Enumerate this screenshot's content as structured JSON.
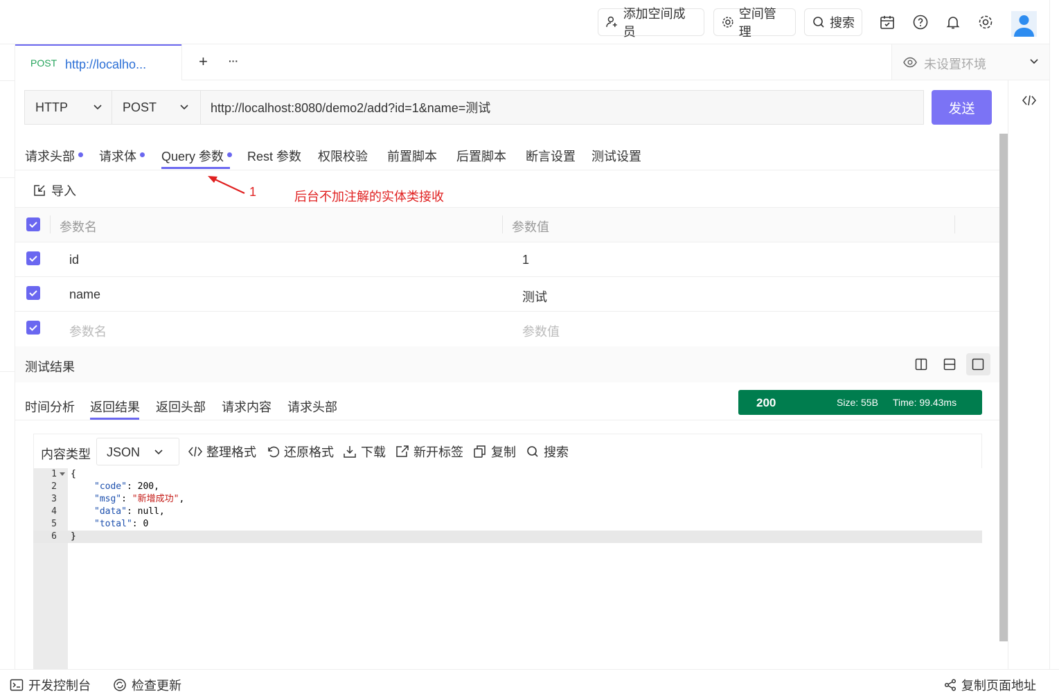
{
  "topbar": {
    "add_member": "添加空间成员",
    "space_manage": "空间管理",
    "search": "搜索"
  },
  "tabs": {
    "method": "POST",
    "title": "http://localho...",
    "add": "+",
    "more": "···"
  },
  "env": {
    "label": "未设置环境"
  },
  "request": {
    "protocol": "HTTP",
    "method": "POST",
    "url": "http://localhost:8080/demo2/add?id=1&name=测试",
    "send": "发送"
  },
  "req_tabs": [
    "请求头部",
    "请求体",
    "Query 参数",
    "Rest 参数",
    "权限校验",
    "前置脚本",
    "后置脚本",
    "断言设置",
    "测试设置"
  ],
  "import_label": "导入",
  "annotation": {
    "number": "1",
    "text": "后台不加注解的实体类接收"
  },
  "params": {
    "header_name": "参数名",
    "header_value": "参数值",
    "rows": [
      {
        "name": "id",
        "value": "1"
      },
      {
        "name": "name",
        "value": "测试"
      }
    ],
    "placeholder_name": "参数名",
    "placeholder_value": "参数值"
  },
  "result": {
    "title": "测试结果",
    "tabs": [
      "时间分析",
      "返回结果",
      "返回头部",
      "请求内容",
      "请求头部"
    ],
    "status": "200",
    "size": "Size: 55B",
    "time": "Time: 99.43ms"
  },
  "toolbar": {
    "content_type_label": "内容类型",
    "content_type": "JSON",
    "format": "整理格式",
    "restore": "还原格式",
    "download": "下载",
    "new_tab": "新开标签",
    "copy": "复制",
    "search": "搜索"
  },
  "code": {
    "lines": [
      {
        "n": "1",
        "t": "{"
      },
      {
        "n": "2",
        "k": "\"code\"",
        "v": ": 200,",
        "vs": ""
      },
      {
        "n": "3",
        "k": "\"msg\"",
        "v": ": ",
        "vs": "\"新增成功\"",
        "tail": ","
      },
      {
        "n": "4",
        "k": "\"data\"",
        "v": ": null,",
        "vs": ""
      },
      {
        "n": "5",
        "k": "\"total\"",
        "v": ": 0",
        "vs": ""
      },
      {
        "n": "6",
        "t": "}"
      }
    ]
  },
  "bottombar": {
    "devtools": "开发控制台",
    "check_update": "检查更新",
    "copy_url": "复制页面地址"
  },
  "colors": {
    "accent": "#6a67f0",
    "status_bg": "#007d4e",
    "annotation": "#e02020"
  }
}
